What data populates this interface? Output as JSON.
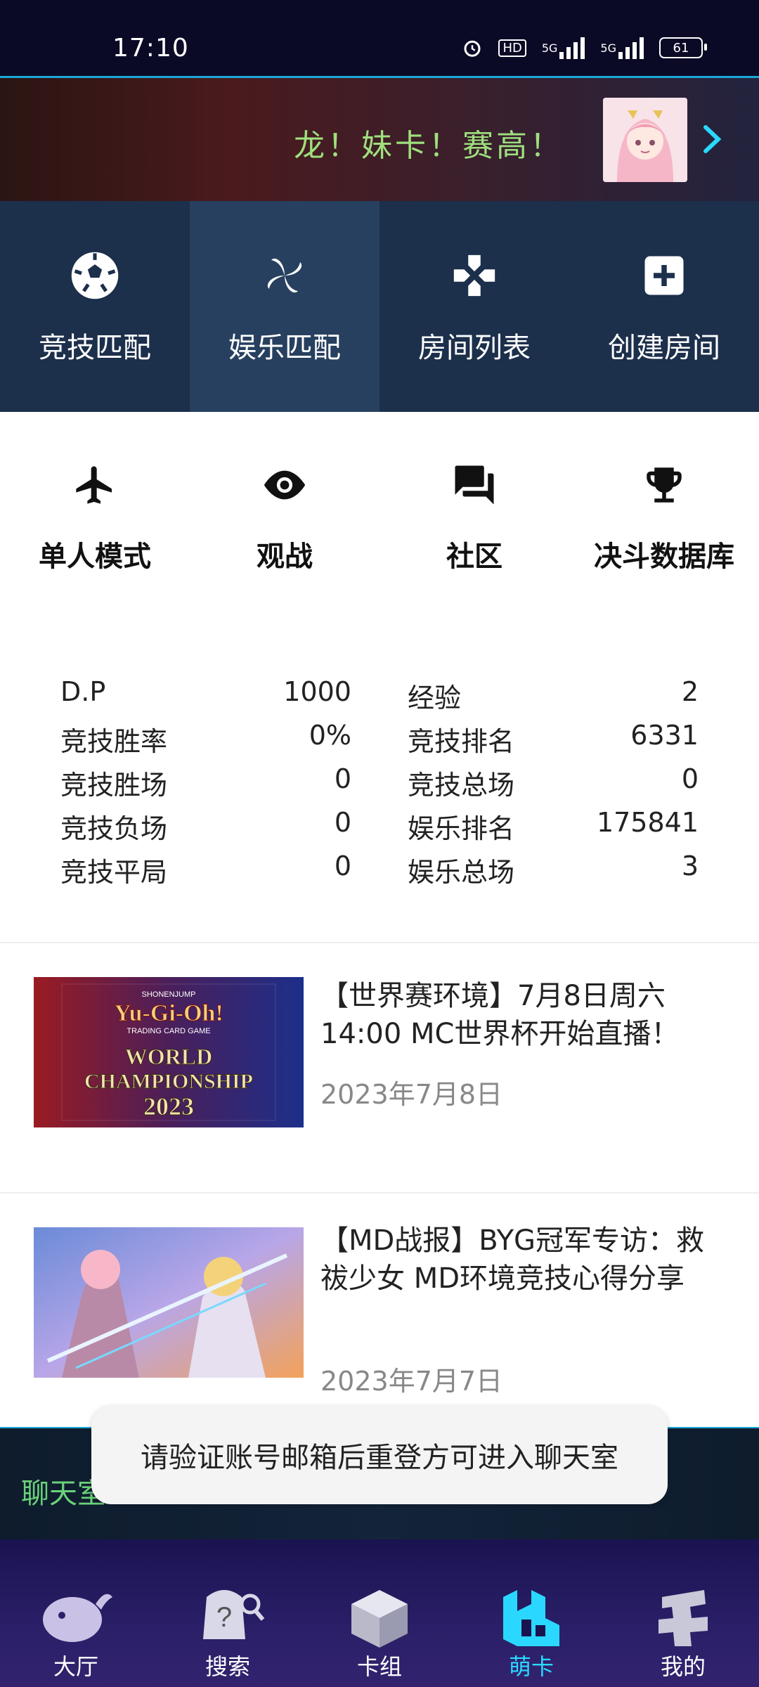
{
  "status_bar": {
    "time": "17:10",
    "hd_label": "HD",
    "network": [
      "5G",
      "5G"
    ],
    "battery": "61"
  },
  "banner": {
    "text": "龙！妹卡！赛高！"
  },
  "modes": [
    {
      "label": "竞技匹配",
      "icon": "soccer-ball-icon"
    },
    {
      "label": "娱乐匹配",
      "icon": "pinwheel-icon"
    },
    {
      "label": "房间列表",
      "icon": "gamepad-icon"
    },
    {
      "label": "创建房间",
      "icon": "add-box-icon"
    }
  ],
  "features": [
    {
      "label": "单人模式",
      "icon": "airplane-icon"
    },
    {
      "label": "观战",
      "icon": "eye-icon"
    },
    {
      "label": "社区",
      "icon": "forum-icon"
    },
    {
      "label": "决斗数据库",
      "icon": "trophy-icon"
    }
  ],
  "stats_left": [
    {
      "label": "D.P",
      "value": "1000"
    },
    {
      "label": "竞技胜率",
      "value": "0%"
    },
    {
      "label": "竞技胜场",
      "value": "0"
    },
    {
      "label": "竞技负场",
      "value": "0"
    },
    {
      "label": "竞技平局",
      "value": "0"
    }
  ],
  "stats_right": [
    {
      "label": "经验",
      "value": "2"
    },
    {
      "label": "竞技排名",
      "value": "6331"
    },
    {
      "label": "竞技总场",
      "value": "0"
    },
    {
      "label": "娱乐排名",
      "value": "175841"
    },
    {
      "label": "娱乐总场",
      "value": "3"
    }
  ],
  "news": [
    {
      "title": "【世界赛环境】7月8日周六14:00 MC世界杯开始直播！",
      "date": "2023年7月8日",
      "thumb_lines": [
        "SHONENJUMP",
        "Yu-Gi-Oh!",
        "TRADING CARD GAME",
        "WORLD",
        "CHAMPIONSHIP",
        "2023"
      ]
    },
    {
      "title": "【MD战报】BYG冠军专访：救祓少女 MD环境竞技心得分享",
      "date": "2023年7月7日"
    }
  ],
  "chat": {
    "label": "聊天室"
  },
  "toast": {
    "text": "请验证账号邮箱后重登方可进入聊天室"
  },
  "nav": [
    {
      "label": "大厅",
      "icon": "whale-icon"
    },
    {
      "label": "搜索",
      "icon": "search-hat-icon"
    },
    {
      "label": "卡组",
      "icon": "deck-box-icon"
    },
    {
      "label": "萌卡",
      "icon": "mycard-logo-icon",
      "active": true
    },
    {
      "label": "我的",
      "icon": "profile-icon"
    }
  ],
  "colors": {
    "accent": "#2ad8ff",
    "banner_text": "#9fe07d",
    "mode_bg": "#1c2f4b"
  }
}
